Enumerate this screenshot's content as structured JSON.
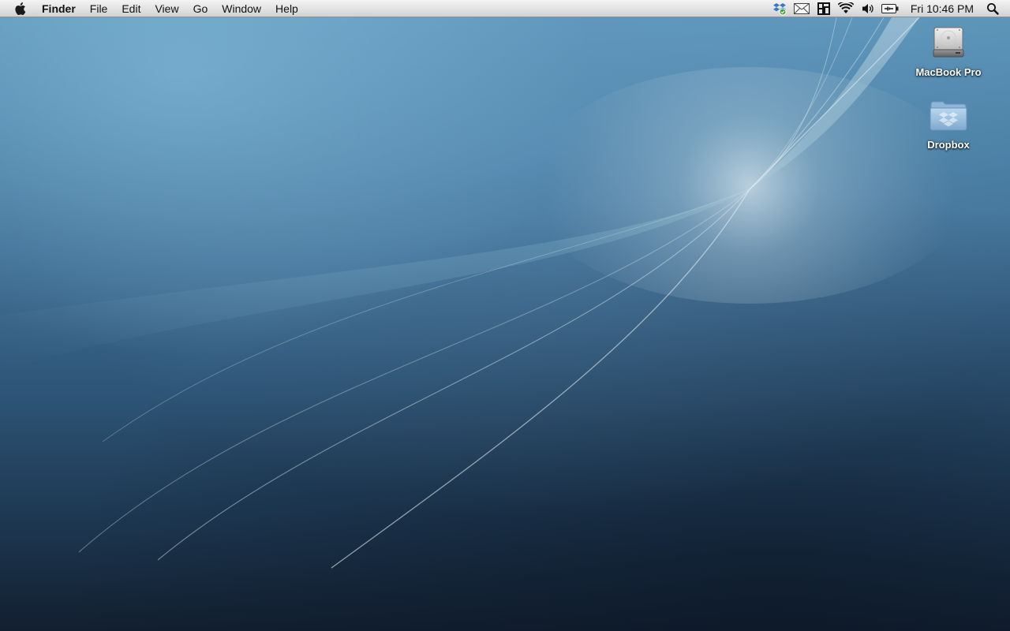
{
  "menubar": {
    "app_name": "Finder",
    "menus": [
      "File",
      "Edit",
      "View",
      "Go",
      "Window",
      "Help"
    ],
    "status_icons": [
      "dropbox-status-icon",
      "mail-icon",
      "app-status-icon",
      "wifi-icon",
      "volume-icon",
      "battery-icon"
    ],
    "clock": "Fri 10:46 PM",
    "search_icon": "spotlight-search-icon"
  },
  "desktop": {
    "icons": [
      {
        "label": "MacBook Pro",
        "icon": "hard-drive-icon"
      },
      {
        "label": "Dropbox",
        "icon": "folder-icon"
      }
    ]
  },
  "colors": {
    "menubar_bg": "#e2e2e2",
    "wallpaper_top": "#5f97bb",
    "wallpaper_bottom": "#121f2f",
    "icon_label": "#ffffff"
  }
}
